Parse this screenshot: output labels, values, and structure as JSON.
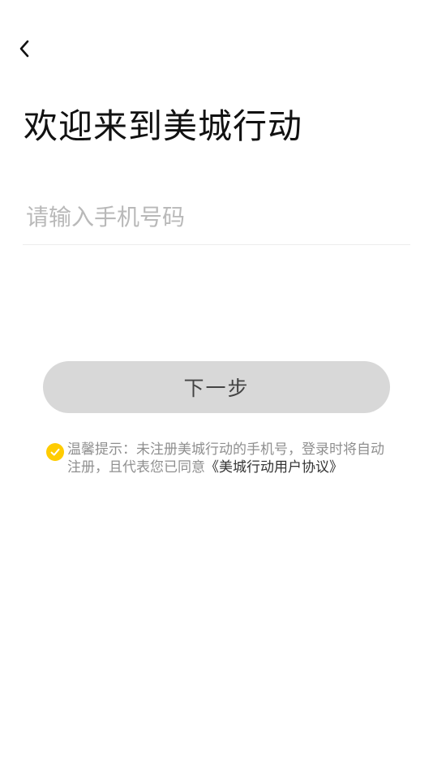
{
  "nav": {
    "back_icon": "chevron-left-icon"
  },
  "page": {
    "title": "欢迎来到美城行动"
  },
  "phone": {
    "value": "",
    "placeholder": "请输入手机号码"
  },
  "next_button": {
    "label": "下一步"
  },
  "tip": {
    "check_icon": "check-circle-icon",
    "text": "温馨提示：未注册美城行动的手机号，登录时将自动注册，且代表您已同意",
    "agreement_link": "《美城行动用户协议》"
  },
  "colors": {
    "accent": "#FFCC00",
    "button_bg": "#D8D8D8",
    "tip_text": "#8F8F8F"
  }
}
